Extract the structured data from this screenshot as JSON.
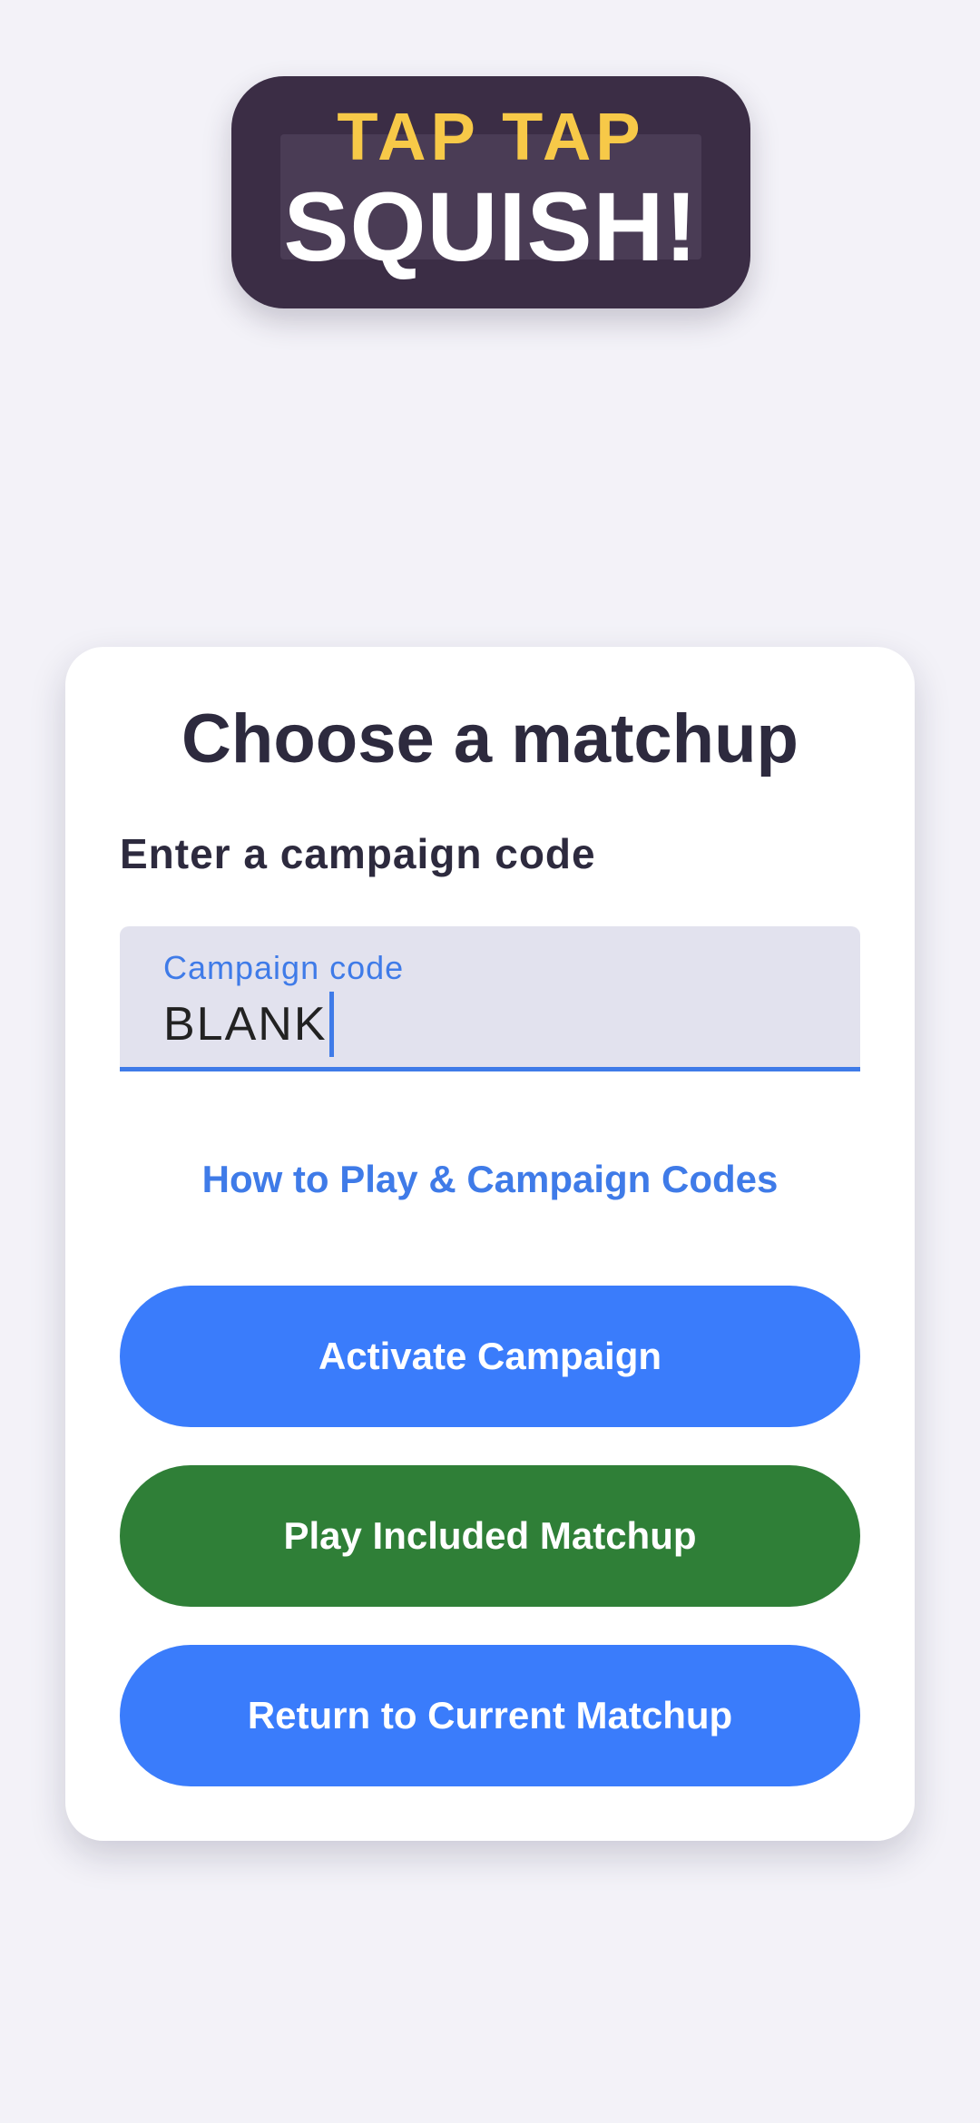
{
  "logo": {
    "line1": "TAP TAP",
    "line2": "SQUISH!"
  },
  "card": {
    "title": "Choose a matchup",
    "section_label": "Enter a campaign code",
    "field": {
      "label": "Campaign code",
      "value": "BLANK"
    },
    "help_link": "How to Play & Campaign Codes",
    "buttons": {
      "activate": "Activate Campaign",
      "play_included": "Play Included Matchup",
      "return_current": "Return to Current Matchup"
    }
  },
  "colors": {
    "background": "#f3f2f8",
    "logo_bg": "#3b2d45",
    "logo_yellow": "#f7c948",
    "primary_blue": "#3a7cfb",
    "accent_green": "#2f7f37",
    "text_dark": "#2d2a3e"
  }
}
